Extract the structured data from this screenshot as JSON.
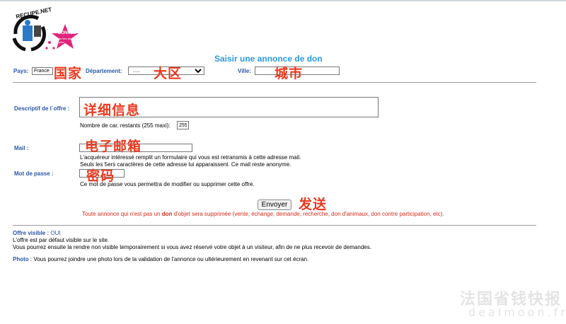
{
  "logo": {
    "brand": "RECUPE.NET",
    "badge": "DONNEZ",
    "badge_sub": "au lieu de jeter"
  },
  "page_title": "Saisir une annonce de don",
  "country": {
    "label": "Pays:",
    "value": "France",
    "overlay": "国家"
  },
  "department": {
    "label": "Département:",
    "value": ".....",
    "overlay": "大区"
  },
  "city": {
    "label": "Ville:",
    "value": "",
    "overlay": "城市"
  },
  "description": {
    "label": "Descriptif de l´offre :",
    "overlay": "详细信息",
    "remaining_label": "Nombre de car. restants (255 maxi):",
    "remaining_value": "255"
  },
  "mail": {
    "label": "Mail :",
    "overlay": "电子邮箱",
    "help1": "L'acquéreur intéressé remplit un formulaire qui vous est retransmis à cette adresse mail.",
    "help2": "Seuls les 5ers caractères de cette adresse lui apparaissent. Ce mail reste anonyme."
  },
  "password": {
    "label": "Mot de passe :",
    "overlay": "密码",
    "help": "Ce mot de passe vous permettra de modifier ou supprimer cette offre."
  },
  "submit": {
    "label": "Envoyer",
    "overlay": "发送"
  },
  "warning": {
    "before": "Toute annonce qui n'est pas un ",
    "bold": "don",
    "after": " d'objet sera supprimée (vente, échange, demande, recherche, don d'animaux, don contre participation, etc)."
  },
  "visible": {
    "label": "Offre visible :",
    "value": "OUI",
    "line1": "L'offre est par défaut visible sur le site.",
    "line2": "Vous pourrez ensuite la rendre non visible temporairement si vous avez réservé votre objet à un visiteur, afin de ne plus recevoir de demandes."
  },
  "photo": {
    "label": "Photo",
    "text": " : Vous pourrez joindre une photo lors de la validation de l'annonce ou ultérieurement en revenant sur cet écran."
  },
  "watermark": {
    "line1": "法国省钱快报",
    "line2": "dealmoon.fr"
  },
  "colors": {
    "accent": "#2a56a8",
    "title": "#2a9ae0",
    "overlay": "#ea3a1f",
    "warning": "#d42a1c",
    "badge": "#e0247c"
  }
}
